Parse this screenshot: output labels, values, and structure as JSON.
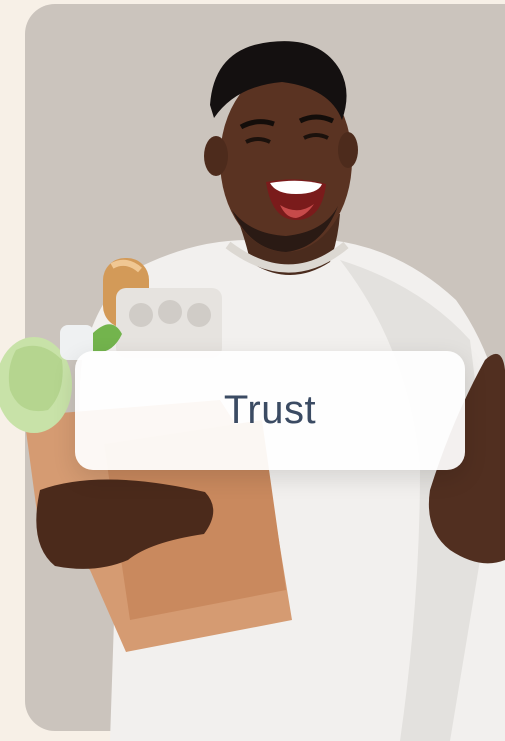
{
  "hero": {
    "image_alt": "smiling-man-holding-grocery-bag",
    "badge_label": "Trust"
  },
  "colors": {
    "page_background": "#f7f0e7",
    "photo_background": "#cbc4bd",
    "badge_text": "#3b4b63"
  }
}
